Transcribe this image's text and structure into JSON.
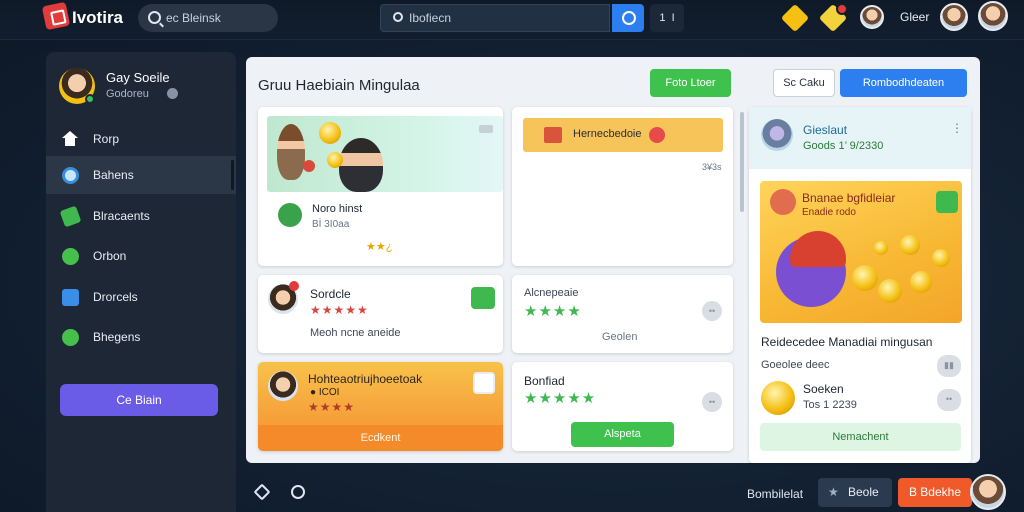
{
  "topbar": {
    "brand": "Ivotira",
    "search_placeholder": "ec Bleinsk",
    "search2_value": "Ibofiecn",
    "counter": "1  I",
    "user_name": "Gleer"
  },
  "sidebar": {
    "profile": {
      "name": "Gay Soeile",
      "subtitle": "Godoreu"
    },
    "items": [
      {
        "label": "Rorp",
        "icon": "home-icon"
      },
      {
        "label": "Bahens",
        "icon": "dollar-icon"
      },
      {
        "label": "Blracaents",
        "icon": "ticket-icon"
      },
      {
        "label": "Orbon",
        "icon": "shield-icon"
      },
      {
        "label": "Drorcels",
        "icon": "puzzle-icon"
      },
      {
        "label": "Bhegens",
        "icon": "chat-icon"
      }
    ],
    "button_label": "Ce Biain"
  },
  "main": {
    "title": "Gruu Haebiain Mingulaa",
    "btn_green": "Foto Ltoer",
    "btn_outline": "Sc Caku",
    "btn_blue": "Rombodhdeaten",
    "card1": {
      "line1": "Noro hinst",
      "line2": "Bİ 3I0aa",
      "stars": "★★¿"
    },
    "card2": {
      "bar_text": "Hernecbedoie",
      "meta": "3¥3s"
    },
    "card3": {
      "title": "Sordcle",
      "stars": "★★★★★",
      "subtitle": "Meoh ncne aneide"
    },
    "card4": {
      "title": "Alcnepeaie",
      "stars": "★★★★",
      "subtitle": "Geolen"
    },
    "card5": {
      "title": "Hohteaotriujhoeetoak",
      "line2": "● ICOI",
      "stars": "★★★★",
      "bottom": "Ecdkent"
    },
    "card6": {
      "title": "Bonfiad",
      "stars": "★★★★★",
      "button": "Alspeta"
    },
    "right_panel": {
      "title": "Gieslaut",
      "subtitle": "Goods 1’ 9/2330",
      "banner_title": "Bnanae bgfidleiar",
      "banner_sub": "Enadie rodo",
      "heading": "Reidecedee Manadiai mingusan",
      "sub": "Goeolee deec",
      "user": "Soeken",
      "user_sub": "Tos 1 2239",
      "button": "Nemachent"
    }
  },
  "bottombar": {
    "text": "Bombilelat",
    "btn1": "Beole",
    "btn2": "B Bdekhe"
  },
  "colors": {
    "accent_blue": "#2d7ff0",
    "accent_green": "#3fc14d",
    "accent_orange": "#f05a2a",
    "accent_purple": "#6b5ce7"
  }
}
